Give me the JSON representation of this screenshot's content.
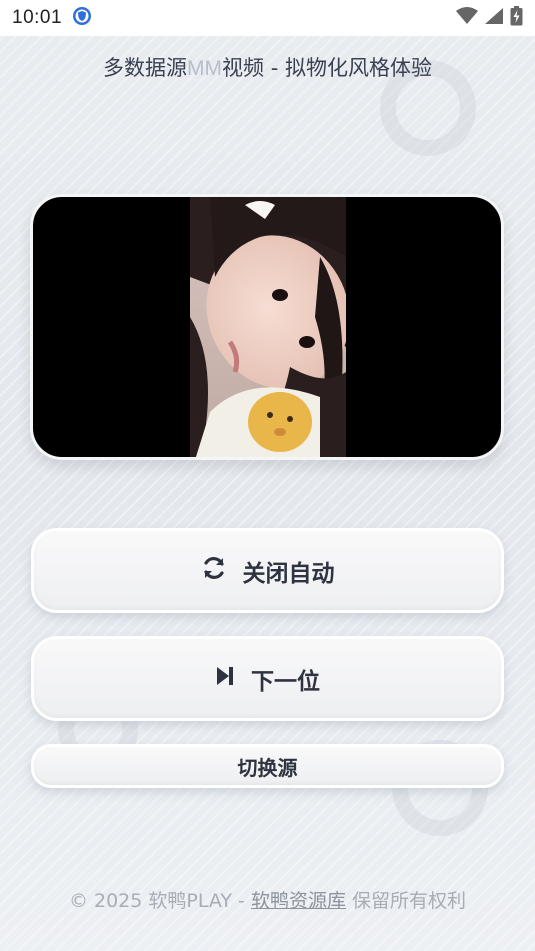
{
  "status_bar": {
    "time": "10:01",
    "icons": [
      "shield-notification-icon",
      "wifi-icon",
      "signal-icon",
      "battery-charging-icon"
    ]
  },
  "header": {
    "title_prefix": "多数据源",
    "title_mm": "MM",
    "title_suffix": "视频 - 拟物化风格体验"
  },
  "video": {
    "content": "portrait video frame"
  },
  "controls": {
    "auto_label": "关闭自动",
    "auto_icon": "refresh-icon",
    "next_label": "下一位",
    "next_icon": "skip-next-icon",
    "source_label": "切换源"
  },
  "footer": {
    "prefix": "© 2025 软鸭PLAY - ",
    "link": "软鸭资源库",
    "suffix": " 保留所有权利"
  },
  "colors": {
    "background": "#eceff3",
    "text_dark": "#2d3340",
    "footer_text": "#a8adb6"
  }
}
